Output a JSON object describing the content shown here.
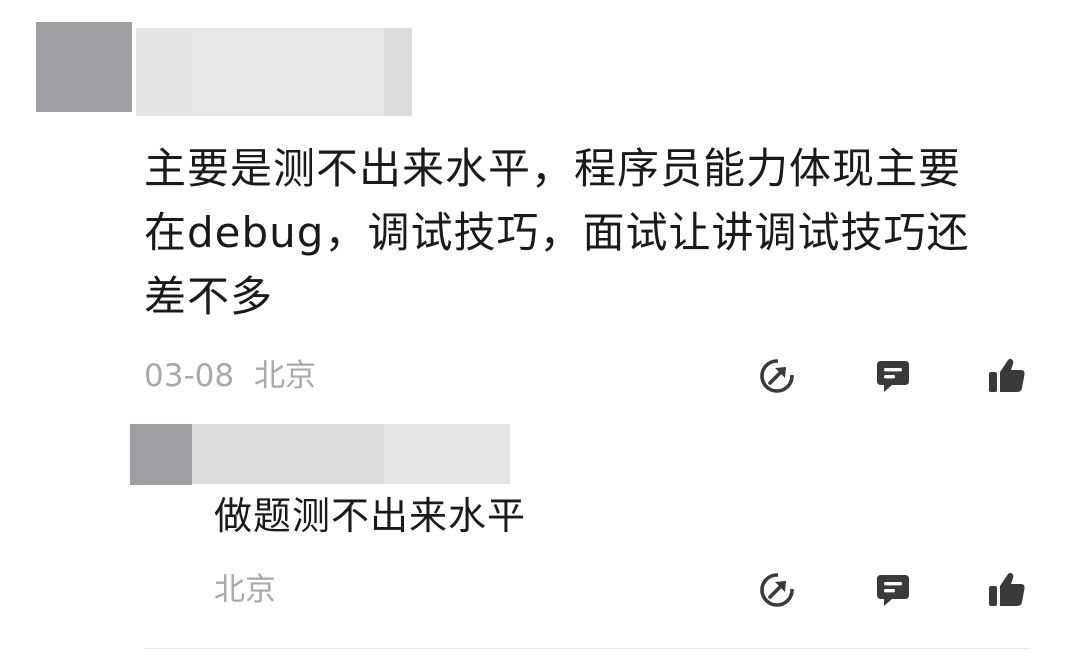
{
  "comment": {
    "text": "主要是测不出来水平，程序员能力体现主要在debug，调试技巧，面试让讲调试技巧还差不多",
    "date": "03-08",
    "location": "北京",
    "actions": {
      "share_icon": "share-icon",
      "reply_icon": "comment-icon",
      "like_icon": "thumbs-up-icon"
    }
  },
  "reply": {
    "text": "做题测不出来水平",
    "location": "北京",
    "actions": {
      "share_icon": "share-icon",
      "reply_icon": "comment-icon",
      "like_icon": "thumbs-up-icon"
    }
  },
  "colors": {
    "text": "#1a1a1a",
    "meta": "#a9a9ad",
    "icon": "#3a3a3c",
    "avatar_blur": "#a09ea3",
    "name_blur_light": "#e7e6e9",
    "name_blur_mid": "#dcdbde"
  }
}
